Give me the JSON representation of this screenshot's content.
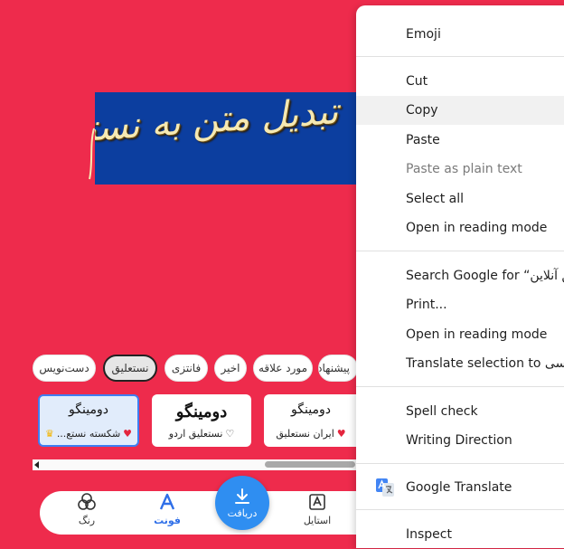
{
  "banner": {
    "text": "تبدیل متن به نستعلیق آنلاین"
  },
  "categories": [
    "دست‌نویس",
    "نستعلیق",
    "فانتزی",
    "اخیر",
    "مورد علاقه",
    "پیشنهادی"
  ],
  "cards": [
    {
      "sample": "دومینگو",
      "name": "شکسته نستع...",
      "favorite": "♥",
      "badge": "♛"
    },
    {
      "sample": "دومینگو",
      "name": "نستعلیق اردو",
      "favorite": "♡"
    },
    {
      "sample": "دومینگو",
      "name": "ایران نستعلیق",
      "favorite": "♥"
    }
  ],
  "bottom_nav": {
    "color_label": "رنگ",
    "font_label": "فونت",
    "download_label": "دریافت",
    "style_label": "استایل"
  },
  "context_menu": {
    "items": [
      {
        "label": "Emoji"
      },
      {
        "label": "Cut"
      },
      {
        "label": "Copy"
      },
      {
        "label": "Paste"
      },
      {
        "label": "Paste as plain text"
      },
      {
        "label": "Select all"
      },
      {
        "label": "Open in reading mode"
      },
      {
        "label": "Search Google for “تبدیل متن به نستعلیق آنلاین”"
      },
      {
        "label": "Print..."
      },
      {
        "label": "Open in reading mode"
      },
      {
        "label": "Translate selection to فارسی"
      },
      {
        "label": "Spell check"
      },
      {
        "label": "Writing Direction"
      },
      {
        "label": "Google Translate"
      },
      {
        "label": "Inspect"
      }
    ]
  },
  "colors": {
    "background": "#ee2b4c",
    "banner": "#0c3e9f",
    "accent": "#2f8ef1"
  }
}
